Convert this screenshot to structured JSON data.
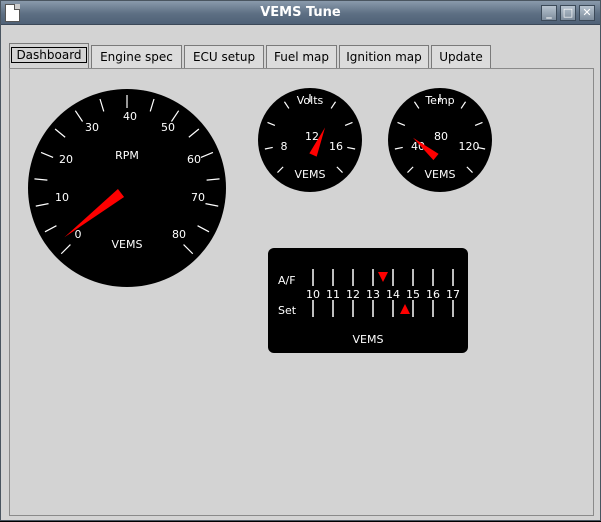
{
  "window": {
    "title": "VEMS Tune"
  },
  "tabs": [
    {
      "label": "Dashboard",
      "active": true
    },
    {
      "label": "Engine spec",
      "active": false
    },
    {
      "label": "ECU setup",
      "active": false
    },
    {
      "label": "Fuel map",
      "active": false
    },
    {
      "label": "Ignition map",
      "active": false
    },
    {
      "label": "Update",
      "active": false
    }
  ],
  "gauges": {
    "rpm": {
      "label": "RPM",
      "brand": "VEMS",
      "min": 0,
      "max": 80,
      "value": 0,
      "ticks": [
        "0",
        "10",
        "20",
        "30",
        "40",
        "50",
        "60",
        "70",
        "80"
      ]
    },
    "volts": {
      "label": "Volts",
      "brand": "VEMS",
      "min": 8,
      "max": 16,
      "value": 12.7,
      "ticks": [
        "8",
        "12",
        "16"
      ]
    },
    "temp": {
      "label": "Temp",
      "brand": "VEMS",
      "min": 40,
      "max": 120,
      "value": 40,
      "ticks": [
        "40",
        "80",
        "120"
      ]
    }
  },
  "af_meter": {
    "brand": "VEMS",
    "row_af_label": "A/F",
    "row_set_label": "Set",
    "scale": [
      "10",
      "11",
      "12",
      "13",
      "14",
      "15",
      "16",
      "17"
    ],
    "af_value": 13.5,
    "set_value": 14.6
  },
  "colors": {
    "needle": "#ff0000",
    "dial": "#000000",
    "text": "#ffffff"
  }
}
